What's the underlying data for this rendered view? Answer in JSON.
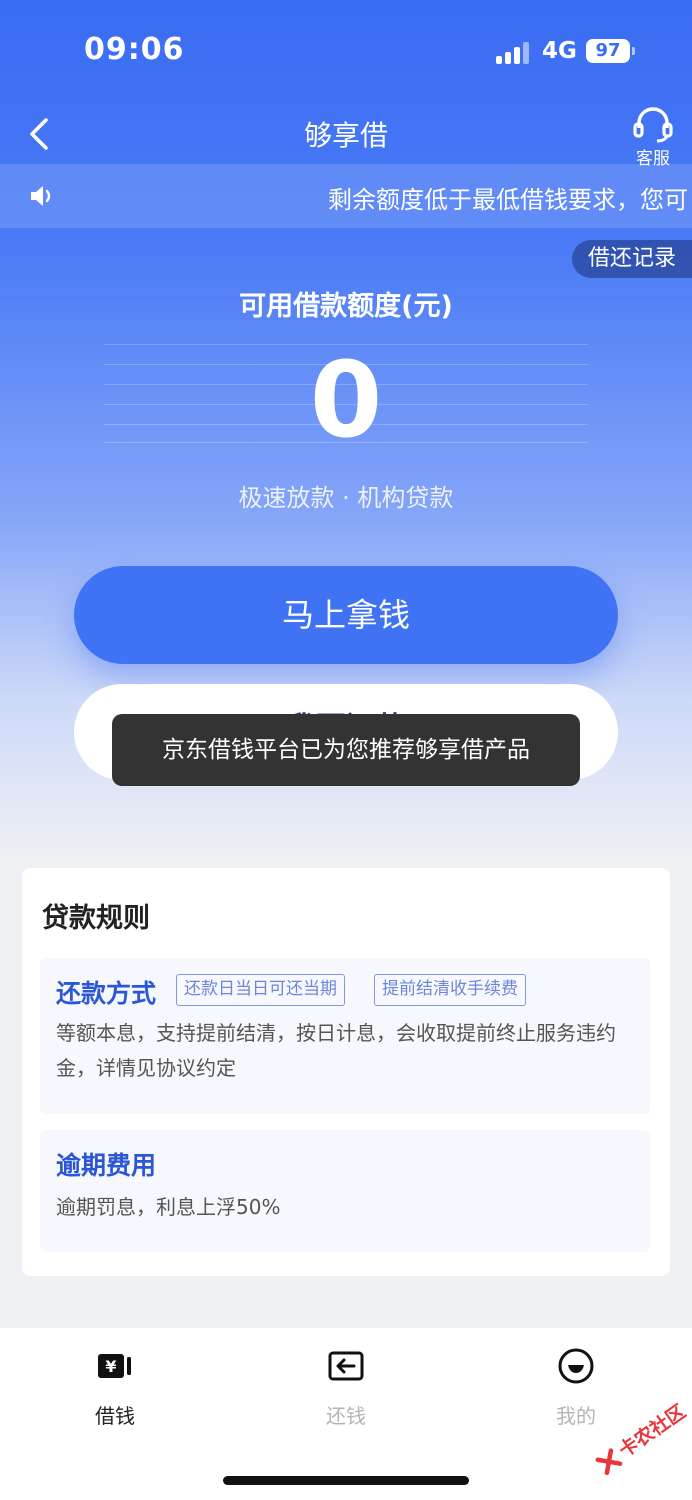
{
  "status_bar": {
    "time": "09:06",
    "network": "4G",
    "battery": "97"
  },
  "nav": {
    "title": "够享借",
    "service_label": "客服"
  },
  "notice": {
    "text": "剩余额度低于最低借钱要求，您可"
  },
  "record_button": {
    "label": "借还记录"
  },
  "limit": {
    "label": "可用借款额度(元)",
    "value": "0",
    "tagline": "极速放款 · 机构贷款"
  },
  "actions": {
    "borrow_label": "马上拿钱",
    "repay_label": "我要还款"
  },
  "toast": {
    "text": "京东借钱平台已为您推荐够享借产品"
  },
  "rules": {
    "title": "贷款规则",
    "repayment": {
      "title": "还款方式",
      "tags": [
        "还款日当日可还当期",
        "提前结清收手续费"
      ],
      "desc": "等额本息，支持提前结清，按日计息，会收取提前终止服务违约金，详情见协议约定"
    },
    "overdue": {
      "title": "逾期费用",
      "desc": "逾期罚息，利息上浮50%"
    }
  },
  "tabbar": {
    "items": [
      {
        "label": "借钱",
        "active": true
      },
      {
        "label": "还钱",
        "active": false
      },
      {
        "label": "我的",
        "active": false
      }
    ],
    "active_color": "#222222",
    "inactive_color": "#b5b5b5"
  },
  "watermark": {
    "text": "卡农社区"
  },
  "colors": {
    "primary": "#3f73f4",
    "accent_text": "#2b56d6"
  }
}
